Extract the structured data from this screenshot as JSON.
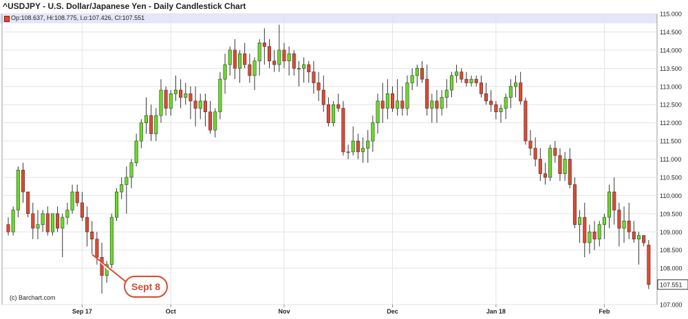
{
  "header": {
    "title": "^USDJPY - U.S. Dollar/Japanese Yen - Daily Candlestick Chart",
    "ohlc": "Op:108.637, Hi:108.775, Lo:107.426, Cl:107.551"
  },
  "credit": "(c) Barchart.com",
  "annotation": {
    "label": "Sept 8",
    "date_index": 17
  },
  "colors": {
    "up": "#66dd22",
    "down": "#e2482f",
    "wick": "#333333",
    "grid": "#e3e3e3",
    "accent": "#d84a2e",
    "ohlc_bg": "#e6e6fa"
  },
  "chart_data": {
    "type": "candlestick",
    "title": "^USDJPY - U.S. Dollar/Japanese Yen - Daily Candlestick Chart",
    "ylim": [
      107.0,
      115.0
    ],
    "y_ticks": [
      "115.000",
      "114.500",
      "114.000",
      "113.500",
      "113.000",
      "112.500",
      "112.000",
      "111.500",
      "111.000",
      "110.500",
      "110.000",
      "109.500",
      "109.000",
      "108.500",
      "108.000",
      "107.000"
    ],
    "last_price_label": "107.551",
    "x_labels": [
      {
        "label": "Sep 17",
        "index": 15
      },
      {
        "label": "Oct",
        "index": 33
      },
      {
        "label": "Nov",
        "index": 56
      },
      {
        "label": "Dec",
        "index": 78
      },
      {
        "label": "Jan 18",
        "index": 99
      },
      {
        "label": "Feb",
        "index": 121
      }
    ],
    "series": [
      [
        109.2,
        109.4,
        108.9,
        109.0
      ],
      [
        109.0,
        109.7,
        108.9,
        109.6
      ],
      [
        109.6,
        110.8,
        109.4,
        110.7
      ],
      [
        110.7,
        110.9,
        109.8,
        110.1
      ],
      [
        110.1,
        110.1,
        109.4,
        109.5
      ],
      [
        109.5,
        109.8,
        108.8,
        109.1
      ],
      [
        109.1,
        109.6,
        108.8,
        109.2
      ],
      [
        109.2,
        109.6,
        109.0,
        109.5
      ],
      [
        109.5,
        109.7,
        108.9,
        109.0
      ],
      [
        109.0,
        109.5,
        108.9,
        109.5
      ],
      [
        109.5,
        109.7,
        109.0,
        109.1
      ],
      [
        109.1,
        109.5,
        108.3,
        109.4
      ],
      [
        109.4,
        109.8,
        109.2,
        109.6
      ],
      [
        109.6,
        110.3,
        109.5,
        110.1
      ],
      [
        110.1,
        110.3,
        109.7,
        109.8
      ],
      [
        109.8,
        110.1,
        109.3,
        109.4
      ],
      [
        109.4,
        109.7,
        108.6,
        109.0
      ],
      [
        109.0,
        109.3,
        108.4,
        108.8
      ],
      [
        108.8,
        109.0,
        108.1,
        108.3
      ],
      [
        108.3,
        108.7,
        107.3,
        107.8
      ],
      [
        107.8,
        108.2,
        107.6,
        108.1
      ],
      [
        108.1,
        109.5,
        108.0,
        109.4
      ],
      [
        109.4,
        110.2,
        109.3,
        110.1
      ],
      [
        110.1,
        110.5,
        109.9,
        110.3
      ],
      [
        110.3,
        110.8,
        109.5,
        110.5
      ],
      [
        110.5,
        111.0,
        110.2,
        110.9
      ],
      [
        110.9,
        111.7,
        110.8,
        111.5
      ],
      [
        111.5,
        112.1,
        111.3,
        112.0
      ],
      [
        112.0,
        112.7,
        111.7,
        112.2
      ],
      [
        112.2,
        112.5,
        111.5,
        111.7
      ],
      [
        111.7,
        112.4,
        111.5,
        112.2
      ],
      [
        112.2,
        113.2,
        112.0,
        112.9
      ],
      [
        112.9,
        113.0,
        112.2,
        112.4
      ],
      [
        112.4,
        112.9,
        112.2,
        112.8
      ],
      [
        112.8,
        113.3,
        112.6,
        112.9
      ],
      [
        112.9,
        113.2,
        112.4,
        112.7
      ],
      [
        112.7,
        113.1,
        112.5,
        112.8
      ],
      [
        112.8,
        113.0,
        112.1,
        112.6
      ],
      [
        112.6,
        113.0,
        111.9,
        112.4
      ],
      [
        112.4,
        112.8,
        112.1,
        112.6
      ],
      [
        112.6,
        112.8,
        111.9,
        112.3
      ],
      [
        112.3,
        112.6,
        111.7,
        111.8
      ],
      [
        111.8,
        112.4,
        111.6,
        112.3
      ],
      [
        112.3,
        113.4,
        112.1,
        113.2
      ],
      [
        113.2,
        113.9,
        112.8,
        113.6
      ],
      [
        113.6,
        114.1,
        113.3,
        114.0
      ],
      [
        114.0,
        114.3,
        113.2,
        113.5
      ],
      [
        113.5,
        114.0,
        113.1,
        113.9
      ],
      [
        113.9,
        114.2,
        113.5,
        113.6
      ],
      [
        113.6,
        113.9,
        113.1,
        113.3
      ],
      [
        113.3,
        113.8,
        112.9,
        113.7
      ],
      [
        113.7,
        114.3,
        113.3,
        114.2
      ],
      [
        114.2,
        114.6,
        113.6,
        114.1
      ],
      [
        114.1,
        114.3,
        113.5,
        113.7
      ],
      [
        113.7,
        114.0,
        113.4,
        113.6
      ],
      [
        113.6,
        114.7,
        113.4,
        114.0
      ],
      [
        114.0,
        114.2,
        113.5,
        113.7
      ],
      [
        113.7,
        114.1,
        113.3,
        113.9
      ],
      [
        113.9,
        114.0,
        113.3,
        113.5
      ],
      [
        113.5,
        113.7,
        113.0,
        113.5
      ],
      [
        113.5,
        113.8,
        113.1,
        113.6
      ],
      [
        113.6,
        113.7,
        113.1,
        113.4
      ],
      [
        113.4,
        113.7,
        112.8,
        113.1
      ],
      [
        113.1,
        113.4,
        112.6,
        112.9
      ],
      [
        112.9,
        113.3,
        112.3,
        112.5
      ],
      [
        112.5,
        112.7,
        111.9,
        112.0
      ],
      [
        112.0,
        112.6,
        111.9,
        112.5
      ],
      [
        112.5,
        112.8,
        112.3,
        112.4
      ],
      [
        112.4,
        112.6,
        111.1,
        111.2
      ],
      [
        111.2,
        111.4,
        111.0,
        111.2
      ],
      [
        111.2,
        111.9,
        111.1,
        111.5
      ],
      [
        111.5,
        111.7,
        111.0,
        111.2
      ],
      [
        111.2,
        111.6,
        110.9,
        111.3
      ],
      [
        111.3,
        111.8,
        110.9,
        111.5
      ],
      [
        111.5,
        112.2,
        111.2,
        112.0
      ],
      [
        112.0,
        112.8,
        111.7,
        112.6
      ],
      [
        112.6,
        113.1,
        112.0,
        112.4
      ],
      [
        112.4,
        113.2,
        112.1,
        112.8
      ],
      [
        112.8,
        113.0,
        112.3,
        112.4
      ],
      [
        112.4,
        113.2,
        112.2,
        112.6
      ],
      [
        112.6,
        113.0,
        112.2,
        112.4
      ],
      [
        112.4,
        113.3,
        112.2,
        113.1
      ],
      [
        113.1,
        113.5,
        112.9,
        113.3
      ],
      [
        113.3,
        113.6,
        113.0,
        113.5
      ],
      [
        113.5,
        113.7,
        113.1,
        113.2
      ],
      [
        113.2,
        113.6,
        112.2,
        112.4
      ],
      [
        112.4,
        112.8,
        112.0,
        112.6
      ],
      [
        112.6,
        112.9,
        112.0,
        112.4
      ],
      [
        112.4,
        112.9,
        112.2,
        112.7
      ],
      [
        112.7,
        113.2,
        112.4,
        112.9
      ],
      [
        112.9,
        113.4,
        112.7,
        113.3
      ],
      [
        113.3,
        113.6,
        113.1,
        113.4
      ],
      [
        113.4,
        113.5,
        113.1,
        113.2
      ],
      [
        113.2,
        113.4,
        113.0,
        113.1
      ],
      [
        113.1,
        113.3,
        113.0,
        113.2
      ],
      [
        113.2,
        113.3,
        113.0,
        113.1
      ],
      [
        113.1,
        113.3,
        112.7,
        112.8
      ],
      [
        112.8,
        113.1,
        112.5,
        112.6
      ],
      [
        112.6,
        112.9,
        112.3,
        112.5
      ],
      [
        112.5,
        112.6,
        112.1,
        112.3
      ],
      [
        112.3,
        112.5,
        112.0,
        112.4
      ],
      [
        112.4,
        112.8,
        112.1,
        112.7
      ],
      [
        112.7,
        113.2,
        112.4,
        113.0
      ],
      [
        113.0,
        113.3,
        112.7,
        113.1
      ],
      [
        113.1,
        113.4,
        112.5,
        112.6
      ],
      [
        112.6,
        112.7,
        111.4,
        111.5
      ],
      [
        111.5,
        111.8,
        111.1,
        111.3
      ],
      [
        111.3,
        111.6,
        110.8,
        111.0
      ],
      [
        111.0,
        111.3,
        110.4,
        110.6
      ],
      [
        110.6,
        110.9,
        110.3,
        110.5
      ],
      [
        110.5,
        111.4,
        110.4,
        111.3
      ],
      [
        111.3,
        111.5,
        110.9,
        111.1
      ],
      [
        111.1,
        111.3,
        110.4,
        110.6
      ],
      [
        110.6,
        111.2,
        110.4,
        111.0
      ],
      [
        111.0,
        111.3,
        110.2,
        110.3
      ],
      [
        110.3,
        110.5,
        109.1,
        109.2
      ],
      [
        109.2,
        109.6,
        108.7,
        109.4
      ],
      [
        109.4,
        109.8,
        108.3,
        108.7
      ],
      [
        108.7,
        109.2,
        108.4,
        109.0
      ],
      [
        109.0,
        109.3,
        108.5,
        108.8
      ],
      [
        108.8,
        109.3,
        108.6,
        109.2
      ],
      [
        109.2,
        109.5,
        108.8,
        109.4
      ],
      [
        109.4,
        110.3,
        109.1,
        110.1
      ],
      [
        110.1,
        110.5,
        109.2,
        109.6
      ],
      [
        109.6,
        109.8,
        108.6,
        109.1
      ],
      [
        109.1,
        109.7,
        108.7,
        109.3
      ],
      [
        109.3,
        109.8,
        108.8,
        109.0
      ],
      [
        109.0,
        109.3,
        108.7,
        108.8
      ],
      [
        108.8,
        109.0,
        108.1,
        108.9
      ],
      [
        108.9,
        108.9,
        108.6,
        108.7
      ],
      [
        108.637,
        108.775,
        107.426,
        107.551
      ]
    ]
  }
}
